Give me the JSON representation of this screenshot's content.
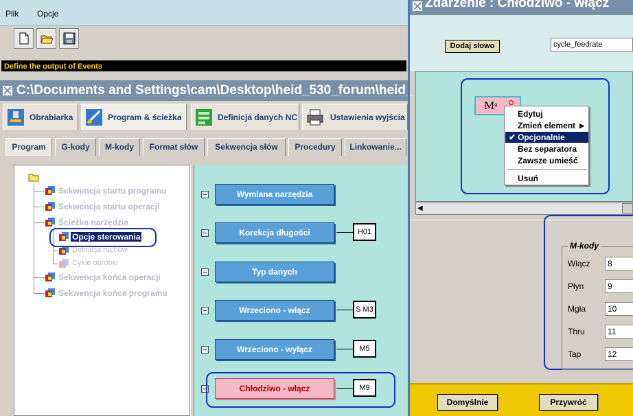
{
  "menu": {
    "file": "Plik",
    "options": "Opcje"
  },
  "status_text": "Define the output of Events",
  "path_title": "C:\\Documents and Settings\\cam\\Desktop\\heid_530_forum\\heid_",
  "main_tabs": [
    {
      "label": "Obrabiarka",
      "icon": "machine-icon"
    },
    {
      "label": "Program & ścieżka",
      "icon": "program-path-icon"
    },
    {
      "label": "Definicja danych NC",
      "icon": "nc-data-icon"
    },
    {
      "label": "Ustawienia wyjścia",
      "icon": "printer-icon"
    }
  ],
  "sub_tabs": [
    "Program",
    "G-kody",
    "M-kody",
    "Format słów",
    "Sekwencja słów",
    "Procedury",
    "Linkowanie..."
  ],
  "tree": [
    "Sekwencja startu programu",
    "Sekwencja startu operacji",
    "Ścieżka narzędzia",
    "Opcje sterowania",
    "Definicja ruchów",
    "Cykle obróbki",
    "Sekwencja końca operacji",
    "Sekwencja końca programu"
  ],
  "flow": [
    {
      "label": "Wymiana narzędzia",
      "value": ""
    },
    {
      "label": "Korekcja długości",
      "value": "H01"
    },
    {
      "label": "Typ danych",
      "value": ""
    },
    {
      "label": "Wrzeciono - włącz",
      "value": "S M3"
    },
    {
      "label": "Wrzeciono - wyłącz",
      "value": "M5"
    },
    {
      "label": "Chłodziwo - włącz",
      "value": "M9"
    }
  ],
  "event_window": {
    "title": "Zdarzenie : Chłodziwo - włącz",
    "add_word": "Dodaj słowo",
    "word_field": "cycle_feedrate",
    "widget_letter": "M",
    "widget_sub": "9",
    "context_menu": [
      "Edytuj",
      "Zmień element",
      "Opcjonalnie",
      "Bez separatora",
      "Zawsze umieść",
      "Usuń"
    ],
    "mcodes_title": "M-kody",
    "mcodes": [
      {
        "label": "Włącz",
        "value": "8"
      },
      {
        "label": "Płyn",
        "value": "9"
      },
      {
        "label": "Mgła",
        "value": "10"
      },
      {
        "label": "Thru",
        "value": "11"
      },
      {
        "label": "Tap",
        "value": "12"
      }
    ],
    "default_button": "Domyślnie",
    "restore_button": "Przywróć"
  },
  "colors": {
    "title_bar": "#7890a8",
    "flow_bg": "#b0e4dc",
    "highlight_oval": "#1030c8",
    "footer": "#f0c800"
  }
}
